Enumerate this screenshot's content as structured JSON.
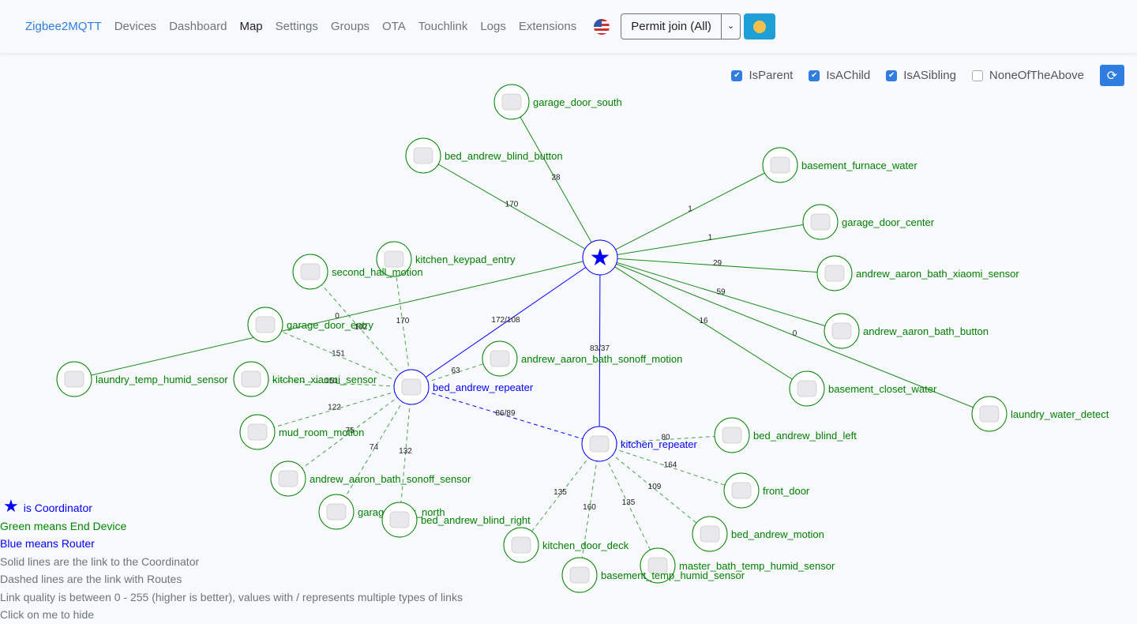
{
  "nav": {
    "brand": "Zigbee2MQTT",
    "items": [
      "Devices",
      "Dashboard",
      "Map",
      "Settings",
      "Groups",
      "OTA",
      "Touchlink",
      "Logs",
      "Extensions"
    ],
    "active": "Map",
    "permit_join": "Permit join (All)",
    "language_icon": "us-flag-icon",
    "theme_icon": "sun-icon"
  },
  "filters": [
    {
      "label": "IsParent",
      "checked": true
    },
    {
      "label": "IsAChild",
      "checked": true
    },
    {
      "label": "IsASibling",
      "checked": true
    },
    {
      "label": "NoneOfTheAbove",
      "checked": false
    }
  ],
  "colors": {
    "end_device": "#008000",
    "router": "#0000ff",
    "accent": "#2f7de1"
  },
  "nodes": [
    {
      "name": "Coordinator",
      "type": "coordinator"
    },
    {
      "name": "garage_door_south",
      "type": "end"
    },
    {
      "name": "bed_andrew_blind_button",
      "type": "end"
    },
    {
      "name": "basement_furnace_water",
      "type": "end"
    },
    {
      "name": "garage_door_center",
      "type": "end"
    },
    {
      "name": "andrew_aaron_bath_xiaomi_sensor",
      "type": "end"
    },
    {
      "name": "andrew_aaron_bath_button",
      "type": "end"
    },
    {
      "name": "basement_closet_water",
      "type": "end"
    },
    {
      "name": "laundry_water_detect",
      "type": "end"
    },
    {
      "name": "kitchen_keypad_entry",
      "type": "end"
    },
    {
      "name": "second_hall_motion",
      "type": "end"
    },
    {
      "name": "garage_door_entry",
      "type": "end"
    },
    {
      "name": "laundry_temp_humid_sensor",
      "type": "end"
    },
    {
      "name": "kitchen_xiaomi_sensor",
      "type": "end"
    },
    {
      "name": "bed_andrew_repeater",
      "type": "router"
    },
    {
      "name": "andrew_aaron_bath_sonoff_motion",
      "type": "end"
    },
    {
      "name": "mud_room_motion",
      "type": "end"
    },
    {
      "name": "andrew_aaron_bath_sonoff_sensor",
      "type": "end"
    },
    {
      "name": "garage_door_north",
      "type": "end"
    },
    {
      "name": "bed_andrew_blind_right",
      "type": "end"
    },
    {
      "name": "kitchen_repeater",
      "type": "router"
    },
    {
      "name": "bed_andrew_blind_left",
      "type": "end"
    },
    {
      "name": "front_door",
      "type": "end"
    },
    {
      "name": "bed_andrew_motion",
      "type": "end"
    },
    {
      "name": "kitchen_door_deck",
      "type": "end"
    },
    {
      "name": "master_bath_temp_humid_sensor",
      "type": "end"
    },
    {
      "name": "basement_temp_humid_sensor",
      "type": "end"
    }
  ],
  "links": [
    {
      "s": "Coordinator",
      "t": "garage_door_south",
      "lqi": "28",
      "style": "solid"
    },
    {
      "s": "Coordinator",
      "t": "bed_andrew_blind_button",
      "lqi": "170",
      "style": "solid"
    },
    {
      "s": "Coordinator",
      "t": "basement_furnace_water",
      "lqi": "1",
      "style": "solid"
    },
    {
      "s": "Coordinator",
      "t": "garage_door_center",
      "lqi": "1",
      "style": "solid"
    },
    {
      "s": "Coordinator",
      "t": "andrew_aaron_bath_xiaomi_sensor",
      "lqi": "29",
      "style": "solid"
    },
    {
      "s": "Coordinator",
      "t": "andrew_aaron_bath_button",
      "lqi": "59",
      "style": "solid"
    },
    {
      "s": "Coordinator",
      "t": "basement_closet_water",
      "lqi": "16",
      "style": "solid"
    },
    {
      "s": "Coordinator",
      "t": "laundry_water_detect",
      "lqi": "0",
      "style": "solid"
    },
    {
      "s": "Coordinator",
      "t": "laundry_temp_humid_sensor",
      "lqi": "0",
      "style": "solid"
    },
    {
      "s": "Coordinator",
      "t": "bed_andrew_repeater",
      "lqi": "172/108",
      "style": "solid"
    },
    {
      "s": "Coordinator",
      "t": "kitchen_repeater",
      "lqi": "83/37",
      "style": "solid"
    },
    {
      "s": "bed_andrew_repeater",
      "t": "kitchen_repeater",
      "lqi": "86/89",
      "style": "dashed"
    },
    {
      "s": "bed_andrew_repeater",
      "t": "second_hall_motion",
      "lqi": "102",
      "style": "dashed"
    },
    {
      "s": "bed_andrew_repeater",
      "t": "kitchen_keypad_entry",
      "lqi": "170",
      "style": "dashed"
    },
    {
      "s": "bed_andrew_repeater",
      "t": "garage_door_entry",
      "lqi": "151",
      "style": "dashed"
    },
    {
      "s": "bed_andrew_repeater",
      "t": "kitchen_xiaomi_sensor",
      "lqi": "151",
      "style": "dashed"
    },
    {
      "s": "bed_andrew_repeater",
      "t": "andrew_aaron_bath_sonoff_motion",
      "lqi": "63",
      "style": "dashed"
    },
    {
      "s": "bed_andrew_repeater",
      "t": "mud_room_motion",
      "lqi": "122",
      "style": "dashed"
    },
    {
      "s": "bed_andrew_repeater",
      "t": "andrew_aaron_bath_sonoff_sensor",
      "lqi": "75",
      "style": "dashed"
    },
    {
      "s": "bed_andrew_repeater",
      "t": "garage_door_north",
      "lqi": "74",
      "style": "dashed"
    },
    {
      "s": "bed_andrew_repeater",
      "t": "bed_andrew_blind_right",
      "lqi": "132",
      "style": "dashed"
    },
    {
      "s": "kitchen_repeater",
      "t": "bed_andrew_blind_left",
      "lqi": "80",
      "style": "dashed"
    },
    {
      "s": "kitchen_repeater",
      "t": "front_door",
      "lqi": "164",
      "style": "dashed"
    },
    {
      "s": "kitchen_repeater",
      "t": "bed_andrew_motion",
      "lqi": "109",
      "style": "dashed"
    },
    {
      "s": "kitchen_repeater",
      "t": "master_bath_temp_humid_sensor",
      "lqi": "135",
      "style": "dashed"
    },
    {
      "s": "kitchen_repeater",
      "t": "basement_temp_humid_sensor",
      "lqi": "160",
      "style": "dashed"
    },
    {
      "s": "kitchen_repeater",
      "t": "kitchen_door_deck",
      "lqi": "135",
      "style": "dashed"
    }
  ],
  "legend": {
    "coordinator": "is Coordinator",
    "end_device": "Green means End Device",
    "router": "Blue means Router",
    "solid": "Solid lines are the link to the Coordinator",
    "dashed": "Dashed lines are the link with Routes",
    "lqi": "Link quality is between 0 - 255 (higher is better), values with / represents multiple types of links",
    "hide": "Click on me to hide"
  }
}
